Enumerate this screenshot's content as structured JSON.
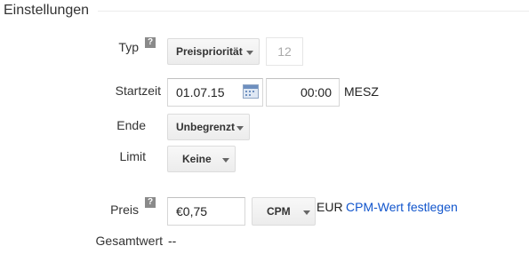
{
  "section": {
    "title": "Einstellungen"
  },
  "help_glyph": "?",
  "typ": {
    "label": "Typ",
    "selected": "Preispriorität",
    "priority_value": "12"
  },
  "startzeit": {
    "label": "Startzeit",
    "date": "01.07.15",
    "time": "00:00",
    "timezone": "MESZ"
  },
  "ende": {
    "label": "Ende",
    "selected": "Unbegrenzt"
  },
  "limit": {
    "label": "Limit",
    "selected": "Keine"
  },
  "preis": {
    "label": "Preis",
    "value": "€0,75",
    "model": "CPM",
    "currency": "EUR",
    "link": "CPM-Wert festlegen"
  },
  "gesamtwert": {
    "label": "Gesamtwert",
    "value": "--"
  },
  "colors": {
    "link": "#1155cc",
    "label": "#333333",
    "help_bg": "#8a8a8a"
  }
}
